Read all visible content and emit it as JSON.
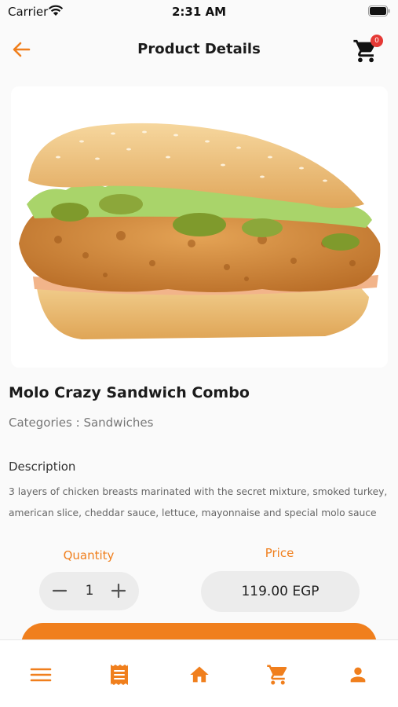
{
  "status_bar": {
    "carrier": "Carrier",
    "time": "2:31 AM"
  },
  "nav": {
    "title": "Product Details",
    "back_icon": "arrow-left-icon",
    "cart_icon": "cart-icon",
    "cart_count": "0"
  },
  "product": {
    "image_icon": "sandwich-photo",
    "name": "Molo Crazy Sandwich Combo",
    "category": "Categories : Sandwiches",
    "description_heading": "Description",
    "description": "3 layers of chicken breasts marinated with the secret mixture, smoked turkey, american slice, cheddar sauce, lettuce, mayonnaise and special molo sauce"
  },
  "order": {
    "quantity_label": "Quantity",
    "quantity_value": "1",
    "price_label": "Price",
    "price_value": "119.00 EGP"
  },
  "tab_bar": {
    "items": [
      {
        "icon": "menu-icon"
      },
      {
        "icon": "receipt-icon"
      },
      {
        "icon": "home-icon"
      },
      {
        "icon": "cart-icon"
      },
      {
        "icon": "user-icon"
      }
    ]
  },
  "colors": {
    "accent": "#f07f1d",
    "badge": "#e53935",
    "pill": "#ececec",
    "background": "#fafafa"
  }
}
